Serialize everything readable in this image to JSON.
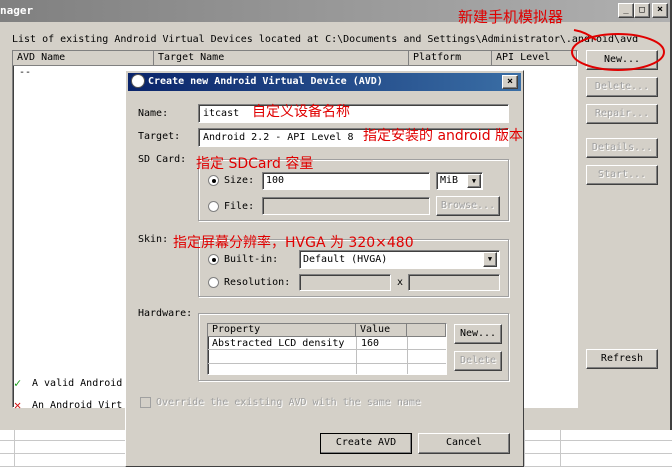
{
  "main_window": {
    "title": "nager",
    "list_caption": "List of existing Android Virtual Devices located at C:\\Documents and Settings\\Administrator\\.android\\avd",
    "columns": [
      "AVD Name",
      "Target Name",
      "Platform",
      "API Level"
    ],
    "empty_row": "--",
    "buttons": {
      "new": "New...",
      "delete": "Delete...",
      "repair": "Repair...",
      "details": "Details...",
      "start": "Start...",
      "refresh": "Refresh"
    },
    "legend": {
      "valid": "A valid Android",
      "invalid": "An Android Virt"
    }
  },
  "dialog": {
    "title": "Create new Android Virtual Device (AVD)",
    "name_label": "Name:",
    "name_value": "itcast",
    "target_label": "Target:",
    "target_value": "Android 2.2 - API Level 8",
    "sdcard_label": "SD Card:",
    "size_label": "Size:",
    "size_value": "100",
    "size_unit": "MiB",
    "file_label": "File:",
    "browse": "Browse...",
    "skin_label": "Skin:",
    "builtin_label": "Built-in:",
    "builtin_value": "Default (HVGA)",
    "resolution_label": "Resolution:",
    "resolution_x": "x",
    "hardware_label": "Hardware:",
    "hw_columns": [
      "Property",
      "Value"
    ],
    "hw_rows": [
      {
        "property": "Abstracted LCD density",
        "value": "160"
      }
    ],
    "hw_new": "New...",
    "hw_delete": "Delete",
    "override": "Override the existing AVD with the same name",
    "create": "Create AVD",
    "cancel": "Cancel"
  },
  "annotations": {
    "new_emulator": "新建手机模拟器",
    "custom_name": "自定义设备名称",
    "target_version": "指定安装的 android 版本",
    "sdcard_capacity": "指定 SDCard 容量",
    "skin_resolution": "指定屏幕分辨率，HVGA 为 320×480"
  },
  "colors": {
    "titlebar_main": "#8c8c8c",
    "titlebar_dialog": "#0a246a",
    "annotation": "#e00000",
    "face": "#d4d0c8"
  }
}
